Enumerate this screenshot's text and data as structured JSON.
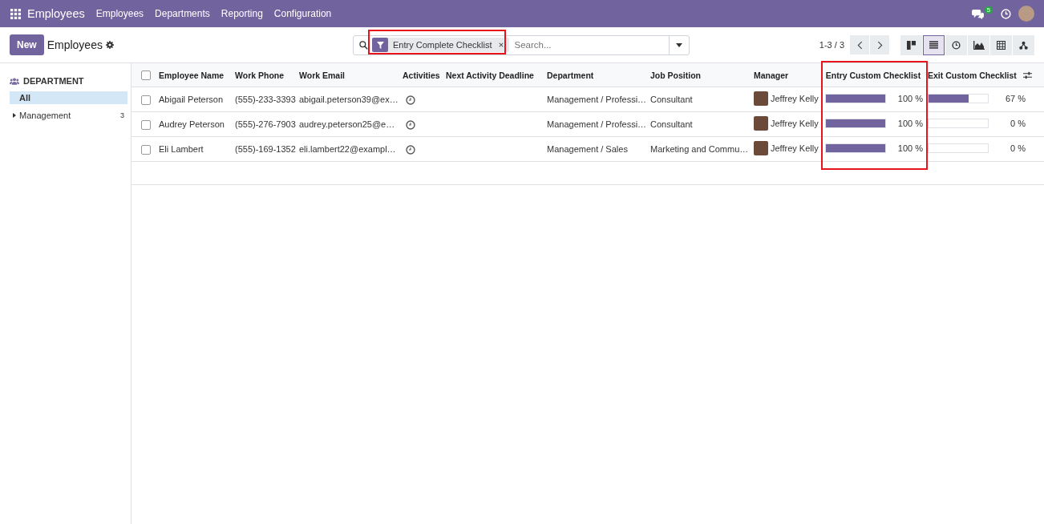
{
  "navbar": {
    "app_name": "Employees",
    "menu": [
      "Employees",
      "Departments",
      "Reporting",
      "Configuration"
    ],
    "message_count": "5"
  },
  "control_panel": {
    "new_button": "New",
    "breadcrumb": "Employees",
    "facet": "Entry Complete Checklist",
    "search_placeholder": "Search...",
    "pager": "1-3 / 3",
    "views": [
      {
        "kind": "kanban",
        "selected": false
      },
      {
        "kind": "list",
        "selected": true
      },
      {
        "kind": "activity",
        "selected": false
      },
      {
        "kind": "graph",
        "selected": false
      },
      {
        "kind": "pivot",
        "selected": false
      },
      {
        "kind": "hierarchy",
        "selected": false
      }
    ]
  },
  "sidebar": {
    "heading": "DEPARTMENT",
    "items": [
      {
        "label": "All",
        "selected": true
      },
      {
        "label": "Management",
        "count": "3",
        "selected": false,
        "expanded": false
      }
    ]
  },
  "table": {
    "all_checked": false,
    "columns": [
      "Employee Name",
      "Work Phone",
      "Work Email",
      "Activities",
      "Next Activity Deadline",
      "Department",
      "Job Position",
      "Manager",
      "Entry Custom Checklist",
      "Exit Custom Checklist"
    ],
    "rows": [
      {
        "checked": false,
        "name": "Abigail Peterson",
        "phone": "(555)-233-3393",
        "email": "abigail.peterson39@ex…",
        "department": "Management / Professi…",
        "job": "Consultant",
        "manager": "Jeffrey Kelly",
        "entry": {
          "level": 1,
          "reading": "100 %"
        },
        "exit": {
          "level": 0.67,
          "reading": "67 %"
        }
      },
      {
        "checked": false,
        "name": "Audrey Peterson",
        "phone": "(555)-276-7903",
        "email": "audrey.peterson25@e…",
        "department": "Management / Professi…",
        "job": "Consultant",
        "manager": "Jeffrey Kelly",
        "entry": {
          "level": 1,
          "reading": "100 %"
        },
        "exit": {
          "level": 0,
          "reading": "0 %"
        }
      },
      {
        "checked": false,
        "name": "Eli Lambert",
        "phone": "(555)-169-1352",
        "email": "eli.lambert22@exampl…",
        "department": "Management / Sales",
        "job": "Marketing and Commu…",
        "manager": "Jeffrey Kelly",
        "entry": {
          "level": 1,
          "reading": "100 %"
        },
        "exit": {
          "level": 0,
          "reading": "0 %"
        }
      }
    ]
  }
}
